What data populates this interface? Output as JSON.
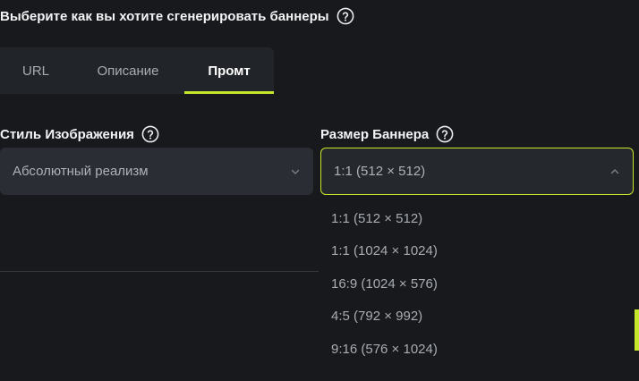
{
  "page": {
    "heading": "Выберите как вы хотите сгенерировать баннеры"
  },
  "tabs": [
    {
      "label": "URL",
      "active": false
    },
    {
      "label": "Описание",
      "active": false
    },
    {
      "label": "Промт",
      "active": true
    }
  ],
  "style_field": {
    "label": "Стиль Изображения",
    "value": "Абсолютный реализм"
  },
  "size_field": {
    "label": "Размер Баннера",
    "value": "1:1 (512 × 512)",
    "options": [
      "1:1 (512 × 512)",
      "1:1 (1024 × 1024)",
      "16:9 (1024 × 576)",
      "4:5 (792 × 992)",
      "9:16 (576 × 1024)"
    ]
  },
  "colors": {
    "background": "#17191c",
    "panel": "#2a2d33",
    "accent": "#c6e82a",
    "muted_text": "#a9adb3"
  },
  "icons": [
    "help-circle-icon",
    "chevron-down-icon",
    "chevron-up-icon"
  ]
}
